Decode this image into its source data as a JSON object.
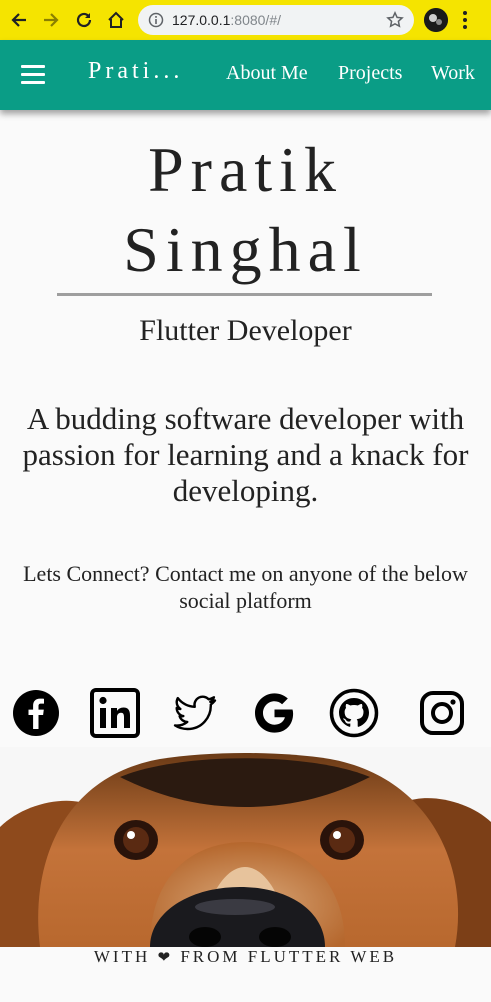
{
  "browser": {
    "url_host": "127.0.0.1",
    "url_rest": ":8080/#/"
  },
  "appbar": {
    "brand": "Prati...",
    "nav": [
      "About Me",
      "Projects",
      "Work"
    ]
  },
  "hero": {
    "name_line1": "Pratik",
    "name_line2": "Singhal",
    "role": "Flutter Developer",
    "tagline": "A budding software developer with passion for learning and a knack for developing.",
    "connect": "Lets Connect? Contact me on anyone of the below social platform"
  },
  "social": [
    {
      "icon": "facebook-icon"
    },
    {
      "icon": "linkedin-icon"
    },
    {
      "icon": "twitter-icon"
    },
    {
      "icon": "google-icon"
    },
    {
      "icon": "github-icon"
    },
    {
      "icon": "instagram-icon"
    }
  ],
  "footer": {
    "before": "WITH",
    "heart": "❤",
    "after": "FROM FLUTTER WEB"
  },
  "colors": {
    "appbar": "#0a9d86",
    "browser_frame": "#f5e400"
  }
}
